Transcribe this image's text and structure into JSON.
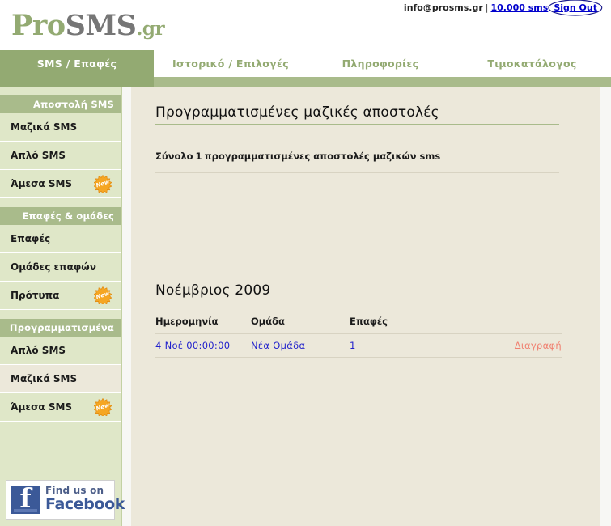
{
  "account": {
    "email": "info@prosms.gr",
    "separator": "|",
    "credits": "10.000 sms",
    "signout": "Sign Out"
  },
  "logo": {
    "part1": "Pro",
    "part2": "SMS",
    "part3": ".gr"
  },
  "nav": {
    "tabs": [
      {
        "label": "SMS / Επαφές",
        "active": true
      },
      {
        "label": "Ιστορικό / Επιλογές",
        "active": false
      },
      {
        "label": "Πληροφορίες",
        "active": false
      },
      {
        "label": "Τιμοκατάλογος",
        "active": false
      }
    ]
  },
  "sidebar": {
    "sections": [
      {
        "title": "Αποστολή SMS",
        "items": [
          {
            "label": "Μαζικά SMS",
            "badge": "",
            "active": false
          },
          {
            "label": "Απλό SMS",
            "badge": "",
            "active": false
          },
          {
            "label": "Άμεσα SMS",
            "badge": "New",
            "active": false
          }
        ]
      },
      {
        "title": "Επαφές & ομάδες",
        "items": [
          {
            "label": "Επαφές",
            "badge": "",
            "active": false
          },
          {
            "label": "Ομάδες επαφών",
            "badge": "",
            "active": false
          },
          {
            "label": "Πρότυπα",
            "badge": "New",
            "active": false
          }
        ]
      },
      {
        "title": "Προγραμματισμένα",
        "items": [
          {
            "label": "Απλό SMS",
            "badge": "",
            "active": false
          },
          {
            "label": "Μαζικά SMS",
            "badge": "",
            "active": true
          },
          {
            "label": "Άμεσα SMS",
            "badge": "New",
            "active": false
          }
        ]
      }
    ],
    "facebook": {
      "line1": "Find us on",
      "line2": "Facebook",
      "glyph": "f"
    }
  },
  "main": {
    "title": "Προγραμματισμένες μαζικές αποστολές",
    "summary_prefix": "Σύνολο",
    "summary_count": "1",
    "summary_suffix": "προγραμματισμένες αποστολές μαζικών sms",
    "month_title": "Νοέμβριος 2009",
    "table": {
      "columns": [
        "Ημερομηνία",
        "Ομάδα",
        "Επαφές",
        ""
      ],
      "rows": [
        {
          "date": "4 Νοέ   00:00:00",
          "group": "Νέα Ομάδα",
          "contacts": "1",
          "action": "Διαγραφή"
        }
      ]
    }
  },
  "colors": {
    "nav_active": "#93aa72",
    "nav_bar": "#a9bb8b",
    "sidebar_bg": "#dfe7c8",
    "content_bg": "#ece8da",
    "link_blue": "#2222cc",
    "delete_link": "#f08070",
    "badge_orange": "#f5a623",
    "facebook_blue": "#3b5998"
  }
}
